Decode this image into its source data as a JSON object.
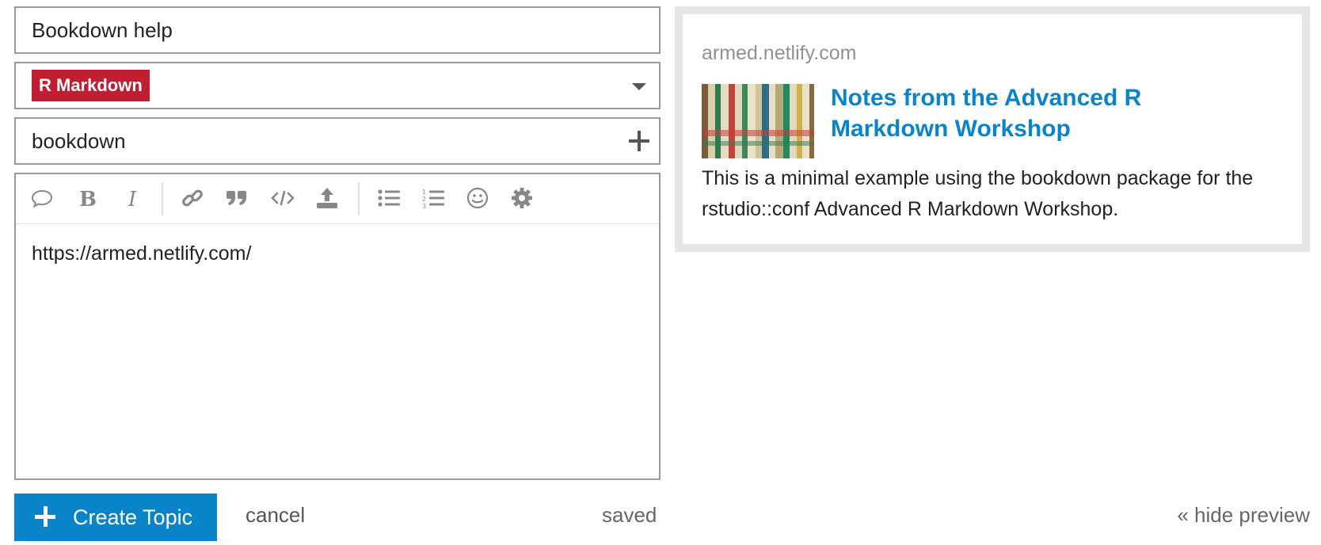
{
  "composer": {
    "title_value": "Bookdown help",
    "category": {
      "label": "R Markdown",
      "color": "#c01f32"
    },
    "tag_value": "bookdown",
    "toolbar": {
      "buttons": [
        "quote-icon",
        "bold-icon",
        "italic-icon",
        "link-icon",
        "blockquote-icon",
        "code-icon",
        "upload-icon",
        "bullet-list-icon",
        "numbered-list-icon",
        "emoji-icon",
        "gear-icon"
      ]
    },
    "body_text": "https://armed.netlify.com/"
  },
  "preview": {
    "domain": "armed.netlify.com",
    "title": "Notes from the Advanced R Markdown Workshop",
    "description": "This is a minimal example using the bookdown package for the rstudio::conf Advanced R Markdown Workshop.",
    "link_color": "#0a84c9"
  },
  "footer": {
    "create_label": "Create Topic",
    "cancel_label": "cancel",
    "status": "saved",
    "hide_preview_label": "« hide preview"
  }
}
